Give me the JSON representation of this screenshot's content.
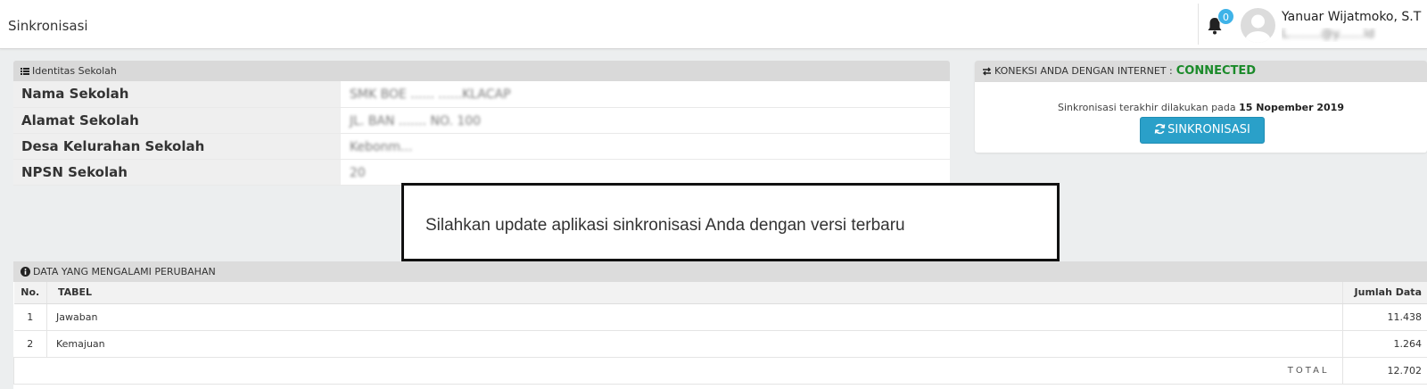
{
  "header": {
    "title": "Sinkronisasi",
    "notification_count": "0",
    "user_name": "Yanuar Wijatmoko, S.T",
    "user_email": "L.........@y.......ld"
  },
  "identity_panel": {
    "heading": "Identitas Sekolah",
    "rows": [
      {
        "label": "Nama Sekolah",
        "value": "SMK BOE ...... ......KLACAP"
      },
      {
        "label": "Alamat Sekolah",
        "value": "JL. BAN ....... NO. 100"
      },
      {
        "label": "Desa Kelurahan Sekolah",
        "value": "Kebonm..."
      },
      {
        "label": "NPSN Sekolah",
        "value": "20"
      }
    ]
  },
  "connection_panel": {
    "heading": "KONEKSI ANDA DENGAN INTERNET :",
    "status": "CONNECTED",
    "last_sync_prefix": "Sinkronisasi terakhir dilakukan pada",
    "last_sync_date": "15 Nopember 2019",
    "sync_button_label": "SINKRONISASI"
  },
  "popup": {
    "message": "Silahkan update aplikasi sinkronisasi Anda dengan versi terbaru"
  },
  "data_panel": {
    "heading": "DATA YANG MENGALAMI PERUBAHAN",
    "columns": [
      "No.",
      "TABEL",
      "Jumlah Data"
    ],
    "rows": [
      {
        "no": "1",
        "table": "Jawaban",
        "count": "11.438"
      },
      {
        "no": "2",
        "table": "Kemajuan",
        "count": "1.264"
      }
    ],
    "total_label": "TOTAL",
    "total_value": "12.702"
  },
  "colors": {
    "connected": "#1b8a2a",
    "sync_button": "#2aa0c9",
    "badge": "#3fb3e8"
  }
}
